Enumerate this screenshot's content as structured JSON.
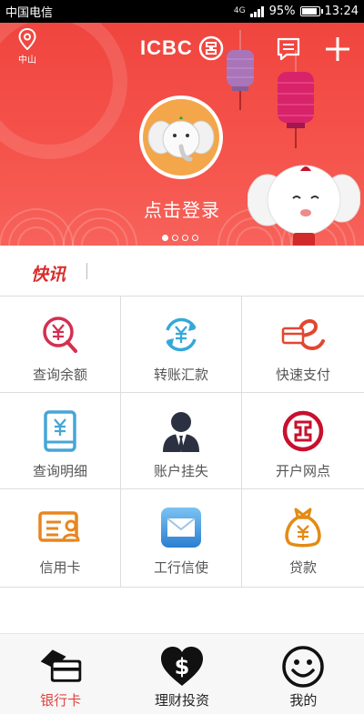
{
  "status": {
    "carrier": "中国电信",
    "signal": "4G",
    "battery": "95%",
    "battery_level": 0.95,
    "time": "13:24"
  },
  "header": {
    "location": "中山",
    "brand": "ICBC",
    "login_text": "点击登录"
  },
  "carousel": {
    "total": 4,
    "active": 1
  },
  "news": {
    "label": "快讯"
  },
  "grid": [
    {
      "label": "查询余额",
      "icon": "yen-search-icon",
      "color": "#d3304f"
    },
    {
      "label": "转账汇款",
      "icon": "yen-transfer-icon",
      "color": "#35a8d8"
    },
    {
      "label": "快速支付",
      "icon": "e-pay-icon",
      "color": "#e2472f"
    },
    {
      "label": "查询明细",
      "icon": "tablet-yen-icon",
      "color": "#46a6d6"
    },
    {
      "label": "账户挂失",
      "icon": "person-tie-icon",
      "color": "#2b3140"
    },
    {
      "label": "开户网点",
      "icon": "icbc-logo-icon",
      "color": "#c8102e"
    },
    {
      "label": "信用卡",
      "icon": "credit-card-icon",
      "color": "#e7861f"
    },
    {
      "label": "工行信使",
      "icon": "envelope-icon",
      "color": "#2f86d1"
    },
    {
      "label": "贷款",
      "icon": "money-bag-icon",
      "color": "#e38b14"
    }
  ],
  "tabs": [
    {
      "label": "银行卡",
      "icon": "bank-card-icon"
    },
    {
      "label": "理财投资",
      "icon": "heart-dollar-icon"
    },
    {
      "label": "我的",
      "icon": "smiley-icon"
    }
  ],
  "colors": {
    "accent": "#e0443f",
    "banner": "#f0453f"
  }
}
